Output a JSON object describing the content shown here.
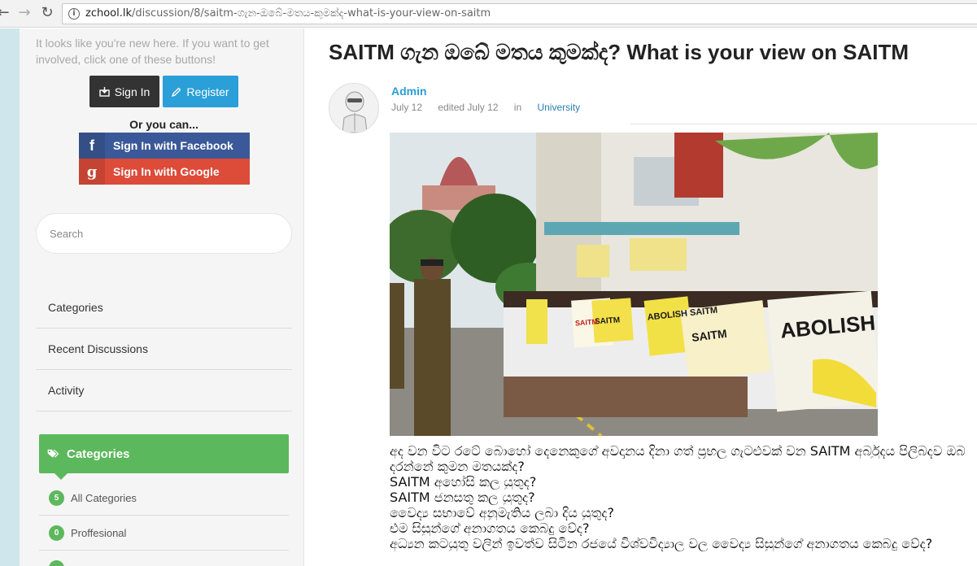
{
  "browser": {
    "url_host": "zchool.lk",
    "url_path": "/discussion/8/saitm-ගැන-ඔබේ-මතය-කුමක්ද-what-is-your-view-on-saitm"
  },
  "sidebar": {
    "welcome_text": "It looks like you're new here. If you want to get involved, click one of these buttons!",
    "signin_label": "Sign In",
    "register_label": "Register",
    "or_text": "Or you can...",
    "facebook_label": "Sign In with Facebook",
    "google_label": "Sign In with Google",
    "search_placeholder": "Search",
    "nav_items": [
      {
        "label": "Categories"
      },
      {
        "label": "Recent Discussions"
      },
      {
        "label": "Activity"
      }
    ],
    "categories_header": "Categories",
    "categories": [
      {
        "count": "5",
        "label": "All Categories"
      },
      {
        "count": "0",
        "label": "Proffesional"
      }
    ]
  },
  "post": {
    "title": "SAITM ගැන ඔබේ මතය කුමක්ද? What is your view on SAITM",
    "author": "Admin",
    "date": "July 12",
    "edited": "edited July 12",
    "category_prefix": "in",
    "category": "University",
    "photo_signs": [
      "ABOLISH SAITM",
      "ABOLISH SAITM",
      "SAITM",
      "SAITM",
      "SAITM"
    ],
    "body_lines": [
      "අද වන විට රටේ බොහෝ දෙනෙකුගේ අවදානය දිනා ගත් ප්‍රභල ගැටළුවක් වන SAITM අර්බුදය පිලිබදව ඔබ",
      "දරන්නේ කුමන මතයක්ද?",
      "SAITM අහෝසි කල යුතුද?",
      "SAITM ජනසතු කල යුතුද?",
      "වෛද්‍ය සභාවේ අනුමැතිය ලබා දිය යුතුද?",
      "එම සිසුන්ගේ අනාගතය කෙබදු වේද?",
      "අධ්‍යන කටයුතු වලින් ඉවත්ව සිටින රජයේ විශ්වවිද්‍යාල වල වෛද්‍ය සිසුන්ගේ අනාගතය කෙබදු වේද?"
    ]
  },
  "colors": {
    "accent_blue": "#2a9fd8",
    "green": "#5cb85c",
    "facebook": "#3b5998",
    "google": "#dd4b39"
  }
}
